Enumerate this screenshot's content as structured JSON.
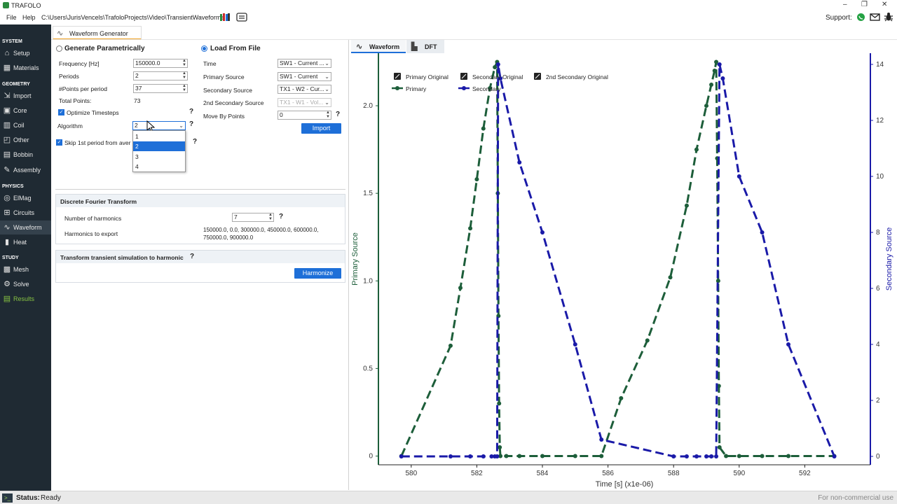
{
  "window": {
    "title": "TRAFOLO",
    "support_label": "Support:",
    "controls": [
      "–",
      "❐",
      "✕"
    ]
  },
  "menu": {
    "items": [
      "File",
      "Help"
    ],
    "path": "C:\\Users\\JurisVencels\\TrafoloProjects\\Video\\TransientWaveforms"
  },
  "sidebar": {
    "sections": [
      "SYSTEM",
      "GEOMETRY",
      "PHYSICS",
      "STUDY"
    ],
    "items": [
      "Setup",
      "Materials",
      "Import",
      "Core",
      "Coil",
      "Other",
      "Bobbin",
      "Assembly",
      "ElMag",
      "Circuits",
      "Waveform",
      "Heat",
      "Mesh",
      "Solve",
      "Results"
    ]
  },
  "tab": {
    "label": "Waveform Generator"
  },
  "parametric": {
    "title": "Generate Parametrically",
    "frequency_label": "Frequency [Hz]",
    "frequency_value": "150000.0",
    "periods_label": "Periods",
    "periods_value": "2",
    "points_label": "#Points per period",
    "points_value": "37",
    "total_label": "Total Points:",
    "total_value": "73",
    "optimize_label": "Optimize Timesteps",
    "algorithm_label": "Algorithm",
    "algorithm_value": "2",
    "skip_label": "Skip 1st period from aver",
    "algorithm_options": [
      "1",
      "2",
      "3",
      "4"
    ]
  },
  "file": {
    "title": "Load From File",
    "time_label": "Time",
    "time_value": "SW1 - Current ...",
    "primary_label": "Primary Source",
    "primary_value": "SW1 - Current",
    "secondary_label": "Secondary Source",
    "secondary_value": "TX1 - W2 - Cur...",
    "secondary2_label": "2nd Secondary Source",
    "secondary2_value": "TX1 - W1 - Vol...",
    "move_label": "Move By Points",
    "move_value": "0",
    "import_label": "Import"
  },
  "dft": {
    "title": "Discrete Fourier Transform",
    "harmonics_label": "Number of harmonics",
    "harmonics_value": "7",
    "export_label": "Harmonics to export",
    "export_line1": "150000.0, 0.0, 300000.0, 450000.0, 600000.0,",
    "export_line2": "750000.0, 900000.0"
  },
  "transform": {
    "title": "Transform transient simulation to harmonic",
    "button_label": "Harmonize"
  },
  "help_mark": "?",
  "right_tabs": [
    "Waveform",
    "DFT"
  ],
  "status": {
    "label": "Status:",
    "value": "Ready",
    "note": "For non-commercial use"
  },
  "colors": {
    "primary": "#1d5e3a",
    "secondary": "#1a1aa8",
    "accent": "#1e6fd8",
    "sidebar": "#1f2a33"
  },
  "chart_data": {
    "type": "line",
    "xlabel": "Time [s] (x1e-06)",
    "ylabel": "Primary Source",
    "y2label": "Secondary Source",
    "xlim": [
      579.0,
      594.0
    ],
    "ylim": [
      -0.05,
      2.3
    ],
    "y2lim": [
      -0.3,
      14.4
    ],
    "xticks": [
      580,
      582,
      584,
      586,
      588,
      590,
      592
    ],
    "yticks": [
      0,
      0.5,
      1.0,
      1.5,
      2.0
    ],
    "yticklabels": [
      "0",
      "0.5",
      "1.0",
      "1.5",
      "2.0"
    ],
    "y2ticks": [
      0,
      2,
      4,
      6,
      8,
      10,
      12,
      14
    ],
    "legend": [
      "Primary Original",
      "Secondary Original",
      "2nd Secondary Original",
      "Primary",
      "Secondary"
    ],
    "series": [
      {
        "name": "Primary",
        "axis": "left",
        "x": [
          579.7,
          581.2,
          581.5,
          581.8,
          582.0,
          582.2,
          582.4,
          582.55,
          582.62,
          582.64,
          582.66,
          582.68,
          582.7,
          582.72,
          582.9,
          583.3,
          584.0,
          585.0,
          585.8,
          586.4,
          587.2,
          587.9,
          588.4,
          588.7,
          589.0,
          589.15,
          589.25,
          589.3,
          589.33,
          589.36,
          589.38,
          589.4,
          589.6,
          590.0,
          590.7,
          591.5,
          592.9
        ],
        "y": [
          0,
          0.63,
          0.96,
          1.3,
          1.58,
          1.87,
          2.1,
          2.22,
          2.25,
          1.5,
          0.8,
          0.3,
          0.05,
          0,
          0,
          0,
          0,
          0,
          0,
          0.33,
          0.66,
          1.02,
          1.43,
          1.75,
          2.0,
          2.12,
          2.2,
          2.25,
          1.7,
          1.0,
          0.4,
          0.05,
          0,
          0,
          0,
          0,
          0
        ]
      },
      {
        "name": "Secondary",
        "axis": "right",
        "x": [
          579.7,
          581.2,
          581.8,
          582.2,
          582.45,
          582.55,
          582.62,
          582.65,
          582.72,
          583.3,
          584.0,
          585.0,
          585.8,
          588.0,
          588.4,
          588.7,
          589.0,
          589.15,
          589.3,
          589.4,
          589.5,
          590.0,
          590.7,
          591.5,
          592.9
        ],
        "y": [
          0,
          0,
          0,
          0,
          0,
          0,
          0,
          14.0,
          13.5,
          10.5,
          8.0,
          4.0,
          0.6,
          0,
          0,
          0,
          0,
          0,
          0,
          14.0,
          13.5,
          10.0,
          8.0,
          4.0,
          0
        ]
      }
    ]
  }
}
